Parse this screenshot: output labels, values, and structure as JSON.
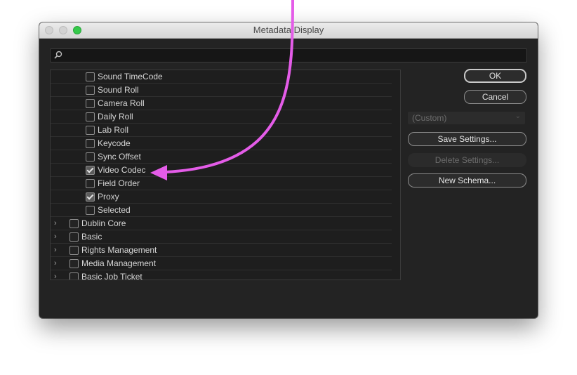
{
  "window": {
    "title": "Metadata Display"
  },
  "search": {
    "placeholder": "",
    "value": ""
  },
  "list": {
    "rows": [
      {
        "label": "Sound TimeCode",
        "checked": false,
        "indent": 1,
        "expandable": false
      },
      {
        "label": "Sound Roll",
        "checked": false,
        "indent": 1,
        "expandable": false
      },
      {
        "label": "Camera Roll",
        "checked": false,
        "indent": 1,
        "expandable": false
      },
      {
        "label": "Daily Roll",
        "checked": false,
        "indent": 1,
        "expandable": false
      },
      {
        "label": "Lab Roll",
        "checked": false,
        "indent": 1,
        "expandable": false
      },
      {
        "label": "Keycode",
        "checked": false,
        "indent": 1,
        "expandable": false
      },
      {
        "label": "Sync Offset",
        "checked": false,
        "indent": 1,
        "expandable": false
      },
      {
        "label": "Video Codec",
        "checked": true,
        "indent": 1,
        "expandable": false
      },
      {
        "label": "Field Order",
        "checked": false,
        "indent": 1,
        "expandable": false
      },
      {
        "label": "Proxy",
        "checked": true,
        "indent": 1,
        "expandable": false
      },
      {
        "label": "Selected",
        "checked": false,
        "indent": 1,
        "expandable": false
      },
      {
        "label": "Dublin Core",
        "checked": false,
        "indent": 0,
        "expandable": true
      },
      {
        "label": "Basic",
        "checked": false,
        "indent": 0,
        "expandable": true
      },
      {
        "label": "Rights Management",
        "checked": false,
        "indent": 0,
        "expandable": true
      },
      {
        "label": "Media Management",
        "checked": false,
        "indent": 0,
        "expandable": true
      },
      {
        "label": "Basic Job Ticket",
        "checked": false,
        "indent": 0,
        "expandable": true
      }
    ]
  },
  "buttons": {
    "ok": "OK",
    "cancel": "Cancel",
    "save_settings": "Save Settings...",
    "delete_settings": "Delete Settings...",
    "new_schema": "New Schema..."
  },
  "settings_select": {
    "value": "(Custom)"
  },
  "icons": {
    "search": "search-icon",
    "expand": "chevron-right-icon",
    "dropdown": "chevron-down-icon"
  },
  "colors": {
    "window_bg": "#232323",
    "list_bg": "#1e1e1e",
    "annotation_arrow": "#e45ce8",
    "zoom_button": "#35c94a"
  }
}
